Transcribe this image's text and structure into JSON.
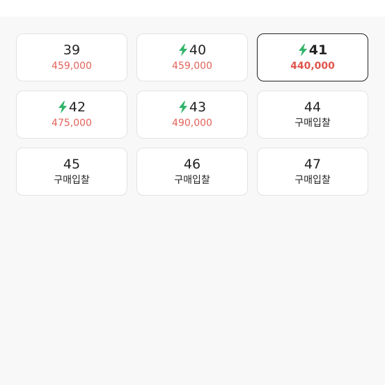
{
  "colors": {
    "page_background": "#f8f8f8",
    "card_background": "#ffffff",
    "card_border": "#e3e3e3",
    "selected_border": "#222222",
    "price_red": "#e2625a",
    "bolt_green": "#31b46a",
    "text_dark": "#222222"
  },
  "selected_size": "41",
  "sizes": [
    {
      "size": "39",
      "fast_delivery": false,
      "price": "459,000",
      "bid_label": null
    },
    {
      "size": "40",
      "fast_delivery": true,
      "price": "459,000",
      "bid_label": null
    },
    {
      "size": "41",
      "fast_delivery": true,
      "price": "440,000",
      "bid_label": null
    },
    {
      "size": "42",
      "fast_delivery": true,
      "price": "475,000",
      "bid_label": null
    },
    {
      "size": "43",
      "fast_delivery": true,
      "price": "490,000",
      "bid_label": null
    },
    {
      "size": "44",
      "fast_delivery": false,
      "price": null,
      "bid_label": "구매입찰"
    },
    {
      "size": "45",
      "fast_delivery": false,
      "price": null,
      "bid_label": "구매입찰"
    },
    {
      "size": "46",
      "fast_delivery": false,
      "price": null,
      "bid_label": "구매입찰"
    },
    {
      "size": "47",
      "fast_delivery": false,
      "price": null,
      "bid_label": "구매입찰"
    }
  ],
  "icons": {
    "fast_delivery": "lightning-bolt-icon"
  }
}
